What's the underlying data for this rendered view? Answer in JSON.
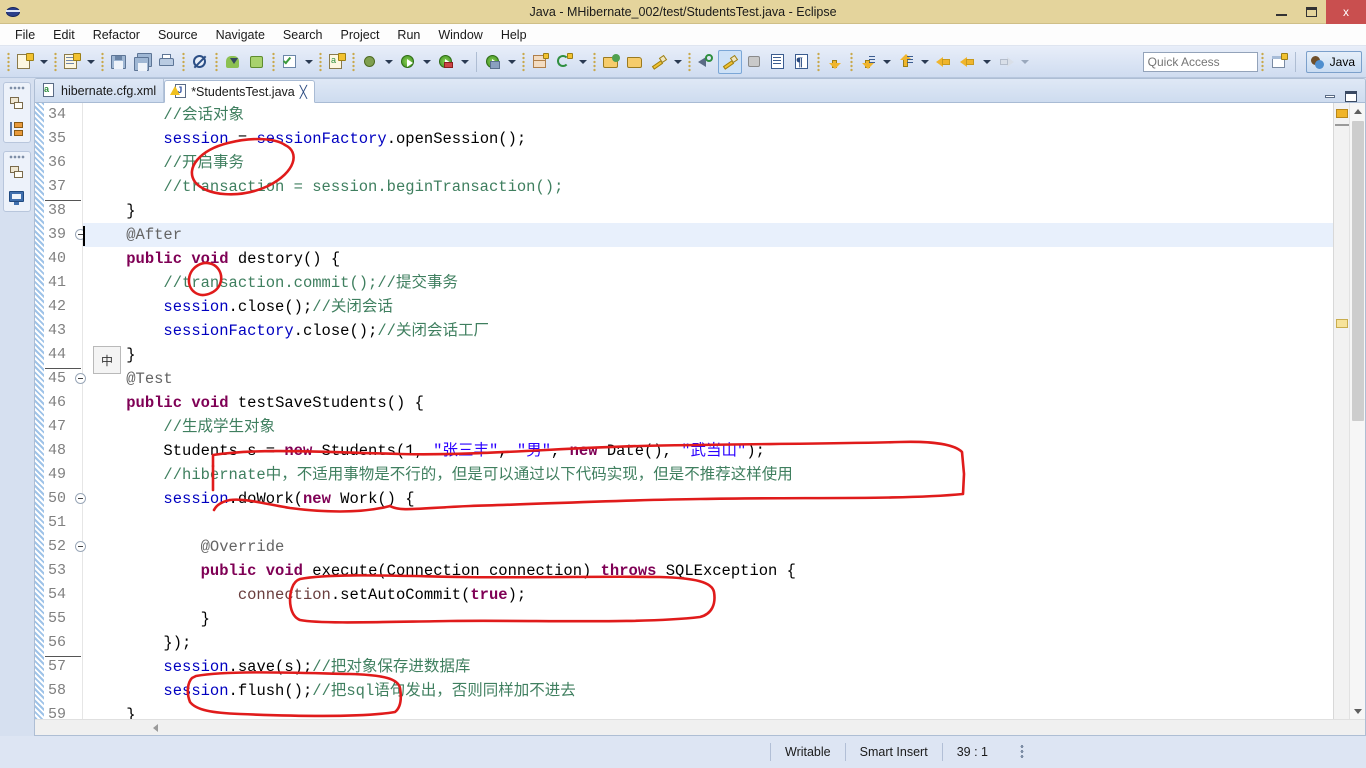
{
  "window": {
    "title": "Java - MHibernate_002/test/StudentsTest.java - Eclipse",
    "app_icon": "eclipse-icon",
    "minimize": "–",
    "maximize": "□",
    "close": "x"
  },
  "menubar": {
    "items": [
      "File",
      "Edit",
      "Refactor",
      "Source",
      "Navigate",
      "Search",
      "Project",
      "Run",
      "Window",
      "Help"
    ]
  },
  "toolbar": {
    "quick_access": {
      "placeholder": "Quick Access",
      "value": ""
    },
    "perspective_button": {
      "label": "Java",
      "icon": "java-perspective-icon"
    },
    "open_perspective_icon": "open-perspective-icon",
    "buttons": [
      "new-wizard-icon",
      "new-wizard-dropdown",
      "new-java-class-icon",
      "new-java-class-dropdown",
      "save-icon",
      "save-all-icon",
      "print-icon",
      "toggle-breakpoint-icon",
      "android-sdk-manager-icon",
      "android-avd-manager-icon",
      "build-all-icon",
      "build-dropdown",
      "new-android-xml-icon",
      "debug-icon",
      "debug-dropdown",
      "run-icon",
      "run-dropdown",
      "run-as-server-icon",
      "run-as-dropdown",
      "external-tools-icon",
      "external-tools-dropdown",
      "new-table-icon",
      "new-connection-icon",
      "new-connection-dropdown",
      "open-type-icon",
      "open-task-icon",
      "open-resource-icon",
      "search-icon",
      "annotation-icon",
      "pin-icon",
      "show-whitespace-icon",
      "show-paragraph-icon",
      "next-annotation-icon",
      "next-annotation-dropdown",
      "previous-annotation-icon",
      "previous-annotation-dropdown",
      "last-edit-location-icon",
      "back-icon",
      "back-dropdown",
      "forward-icon",
      "forward-dropdown"
    ]
  },
  "left_rail": {
    "groups": [
      {
        "items": [
          "restore-icon",
          "package-explorer-icon"
        ]
      },
      {
        "items": [
          "restore-icon",
          "console-icon"
        ]
      }
    ]
  },
  "editor": {
    "tabs": [
      {
        "label": "hibernate.cfg.xml",
        "icon": "xml-file-icon",
        "active": false,
        "dirty": false,
        "closeable": false
      },
      {
        "label": "*StudentsTest.java",
        "icon": "java-file-warning-icon",
        "active": true,
        "dirty": true,
        "closeable": true
      }
    ],
    "tab_controls": {
      "minimize": "minimize-view-icon",
      "maximize": "maximize-view-icon"
    },
    "ime_indicator": "中",
    "first_visible_line": 34,
    "highlighted_line": 39,
    "lines": [
      {
        "num": 34,
        "fold": false,
        "indent": 2,
        "tokens": [
          {
            "t": "//会话对象",
            "c": "cmt"
          }
        ]
      },
      {
        "num": 35,
        "fold": false,
        "indent": 2,
        "tokens": [
          {
            "t": "session",
            "c": "fld"
          },
          {
            "t": " = ",
            "c": "plain"
          },
          {
            "t": "sessionFactory",
            "c": "fld"
          },
          {
            "t": ".openSession();",
            "c": "plain"
          }
        ]
      },
      {
        "num": 36,
        "fold": false,
        "indent": 2,
        "tokens": [
          {
            "t": "//开启事务",
            "c": "cmt"
          }
        ]
      },
      {
        "num": 37,
        "fold": false,
        "indent": 2,
        "tokens": [
          {
            "t": "//transaction = session.beginTransaction();",
            "c": "cmt"
          }
        ]
      },
      {
        "num": 38,
        "fold": false,
        "indent": 1,
        "tokens": [
          {
            "t": "}",
            "c": "plain"
          }
        ]
      },
      {
        "num": 39,
        "fold": true,
        "indent": 1,
        "tokens": [
          {
            "t": "@After",
            "c": "ann"
          }
        ]
      },
      {
        "num": 40,
        "fold": false,
        "indent": 1,
        "tokens": [
          {
            "t": "public",
            "c": "kw"
          },
          {
            "t": " ",
            "c": "plain"
          },
          {
            "t": "void",
            "c": "kw"
          },
          {
            "t": " destory() {",
            "c": "plain"
          }
        ]
      },
      {
        "num": 41,
        "fold": false,
        "indent": 2,
        "tokens": [
          {
            "t": "//transaction.commit();//提交事务",
            "c": "cmt"
          }
        ]
      },
      {
        "num": 42,
        "fold": false,
        "indent": 2,
        "tokens": [
          {
            "t": "session",
            "c": "fld"
          },
          {
            "t": ".close();",
            "c": "plain"
          },
          {
            "t": "//关闭会话",
            "c": "cmt"
          }
        ]
      },
      {
        "num": 43,
        "fold": false,
        "indent": 2,
        "tokens": [
          {
            "t": "sessionFactory",
            "c": "fld"
          },
          {
            "t": ".close();",
            "c": "plain"
          },
          {
            "t": "//关闭会话工厂",
            "c": "cmt"
          }
        ]
      },
      {
        "num": 44,
        "fold": false,
        "indent": 1,
        "tokens": [
          {
            "t": "}",
            "c": "plain"
          }
        ]
      },
      {
        "num": 45,
        "fold": true,
        "indent": 1,
        "tokens": [
          {
            "t": "@Test",
            "c": "ann"
          }
        ]
      },
      {
        "num": 46,
        "fold": false,
        "indent": 1,
        "tokens": [
          {
            "t": "public",
            "c": "kw"
          },
          {
            "t": " ",
            "c": "plain"
          },
          {
            "t": "void",
            "c": "kw"
          },
          {
            "t": " testSaveStudents() {",
            "c": "plain"
          }
        ]
      },
      {
        "num": 47,
        "fold": false,
        "indent": 2,
        "tokens": [
          {
            "t": "//生成学生对象",
            "c": "cmt"
          }
        ]
      },
      {
        "num": 48,
        "fold": false,
        "indent": 2,
        "tokens": [
          {
            "t": "Students s = ",
            "c": "plain"
          },
          {
            "t": "new",
            "c": "kw"
          },
          {
            "t": " Students(1, ",
            "c": "plain"
          },
          {
            "t": "\"张三丰\"",
            "c": "str"
          },
          {
            "t": ", ",
            "c": "plain"
          },
          {
            "t": "\"男\"",
            "c": "str"
          },
          {
            "t": ", ",
            "c": "plain"
          },
          {
            "t": "new",
            "c": "kw"
          },
          {
            "t": " Date(), ",
            "c": "plain"
          },
          {
            "t": "\"武当山\"",
            "c": "str"
          },
          {
            "t": ");",
            "c": "plain"
          }
        ]
      },
      {
        "num": 49,
        "fold": false,
        "indent": 2,
        "tokens": [
          {
            "t": "//hibernate中，不适用事物是不行的，但是可以通过以下代码实现，但是不推荐这样使用",
            "c": "cmt"
          }
        ]
      },
      {
        "num": 50,
        "fold": true,
        "indent": 2,
        "tokens": [
          {
            "t": "session",
            "c": "fld"
          },
          {
            "t": ".doWork(",
            "c": "plain"
          },
          {
            "t": "new",
            "c": "kw"
          },
          {
            "t": " Work() {",
            "c": "plain"
          }
        ]
      },
      {
        "num": 51,
        "fold": false,
        "indent": 0,
        "tokens": [
          {
            "t": "",
            "c": "plain"
          }
        ]
      },
      {
        "num": 52,
        "fold": true,
        "indent": 3,
        "tokens": [
          {
            "t": "@Override",
            "c": "ann"
          }
        ]
      },
      {
        "num": 53,
        "fold": false,
        "indent": 3,
        "tokens": [
          {
            "t": "public",
            "c": "kw"
          },
          {
            "t": " ",
            "c": "plain"
          },
          {
            "t": "void",
            "c": "kw"
          },
          {
            "t": " execute(Connection connection) ",
            "c": "plain"
          },
          {
            "t": "throws",
            "c": "kw"
          },
          {
            "t": " SQLException {",
            "c": "plain"
          }
        ]
      },
      {
        "num": 54,
        "fold": false,
        "indent": 4,
        "tokens": [
          {
            "t": "connection",
            "c": "local"
          },
          {
            "t": ".setAutoCommit(",
            "c": "plain"
          },
          {
            "t": "true",
            "c": "kw"
          },
          {
            "t": ");",
            "c": "plain"
          }
        ]
      },
      {
        "num": 55,
        "fold": false,
        "indent": 3,
        "tokens": [
          {
            "t": "}",
            "c": "plain"
          }
        ]
      },
      {
        "num": 56,
        "fold": false,
        "indent": 2,
        "tokens": [
          {
            "t": "});",
            "c": "plain"
          }
        ]
      },
      {
        "num": 57,
        "fold": false,
        "indent": 2,
        "tokens": [
          {
            "t": "session",
            "c": "fld"
          },
          {
            "t": ".save(s);",
            "c": "plain"
          },
          {
            "t": "//把对象保存进数据库",
            "c": "cmt"
          }
        ]
      },
      {
        "num": 58,
        "fold": false,
        "indent": 2,
        "tokens": [
          {
            "t": "session",
            "c": "fld"
          },
          {
            "t": ".flush();",
            "c": "plain"
          },
          {
            "t": "//把sql语句发出，否则同样加不进去",
            "c": "cmt"
          }
        ]
      },
      {
        "num": 59,
        "fold": false,
        "indent": 1,
        "tokens": [
          {
            "t": "}",
            "c": "plain"
          }
        ]
      }
    ],
    "annotations": {
      "ink_color": "#e01b1b",
      "shapes": [
        "ellipse-around-line36-37-comment-slashes",
        "ellipse-around-line41-comment-slashes",
        "rounded-rect-around-lines48-50-students-constructor-and-dowork",
        "rounded-rect-around-line54-setautocommit",
        "rounded-rect-around-line58-session-flush"
      ]
    }
  },
  "statusbar": {
    "writable": "Writable",
    "insert_mode": "Smart Insert",
    "position": "39 : 1"
  },
  "colors": {
    "titlebar": "#e4d49c",
    "toolbar_top": "#e8eef9",
    "toolbar_bottom": "#cfdcf0",
    "workbench": "#d6e0f0",
    "editor_bg": "#ffffff",
    "highlight_line": "#e8f0fc",
    "keyword": "#7f0055",
    "string": "#2a00ff",
    "comment": "#3f7f5f",
    "field": "#0000c0",
    "annotation_text": "#646464",
    "ink": "#e01b1b",
    "close_button": "#c94f4f"
  }
}
